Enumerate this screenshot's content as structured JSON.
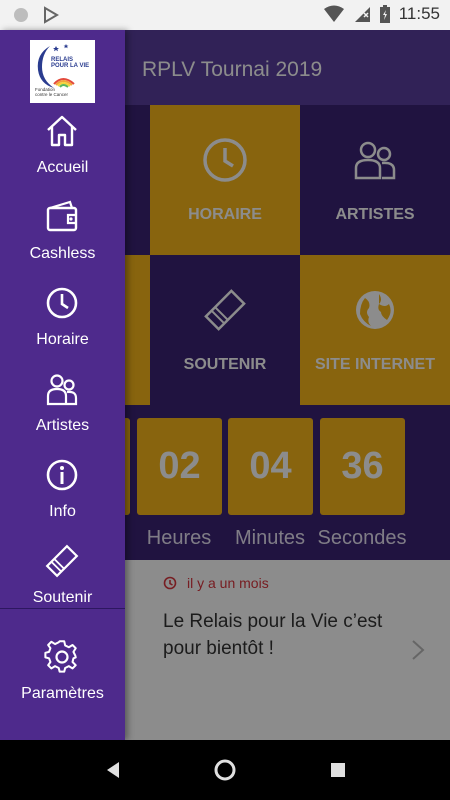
{
  "status_bar": {
    "time": "11:55"
  },
  "app": {
    "title": "RPLV Tournai 2019",
    "tiles": {
      "horaire": "HORAIRE",
      "artistes": "ARTISTES",
      "soutenir": "SOUTENIR",
      "site_internet": "SITE INTERNET"
    },
    "countdown": {
      "hours": "02",
      "minutes": "04",
      "seconds": "36",
      "hours_label": "Heures",
      "minutes_label": "Minutes",
      "seconds_label": "Secondes"
    },
    "news": {
      "time": "il y a un mois",
      "text": "Le Relais pour la Vie c’est pour bientôt !"
    }
  },
  "drawer": {
    "logo": {
      "line1": "RELAIS",
      "line2": "POUR LA VIE",
      "tagline1": "Fondation",
      "tagline2": "contre le Cancer"
    },
    "items": [
      {
        "label": "Accueil",
        "icon": "home-icon"
      },
      {
        "label": "Cashless",
        "icon": "wallet-icon"
      },
      {
        "label": "Horaire",
        "icon": "clock-icon"
      },
      {
        "label": "Artistes",
        "icon": "people-icon"
      },
      {
        "label": "Info",
        "icon": "info-icon"
      },
      {
        "label": "Soutenir",
        "icon": "ticket-icon"
      },
      {
        "label": "Paramètres",
        "icon": "gear-icon"
      }
    ]
  },
  "colors": {
    "drawer": "#4e2a8c",
    "appbar": "#5a3f9e",
    "tile_purple": "#3b2475",
    "tile_gold": "#f7b71b",
    "news_time": "#d9363e"
  }
}
